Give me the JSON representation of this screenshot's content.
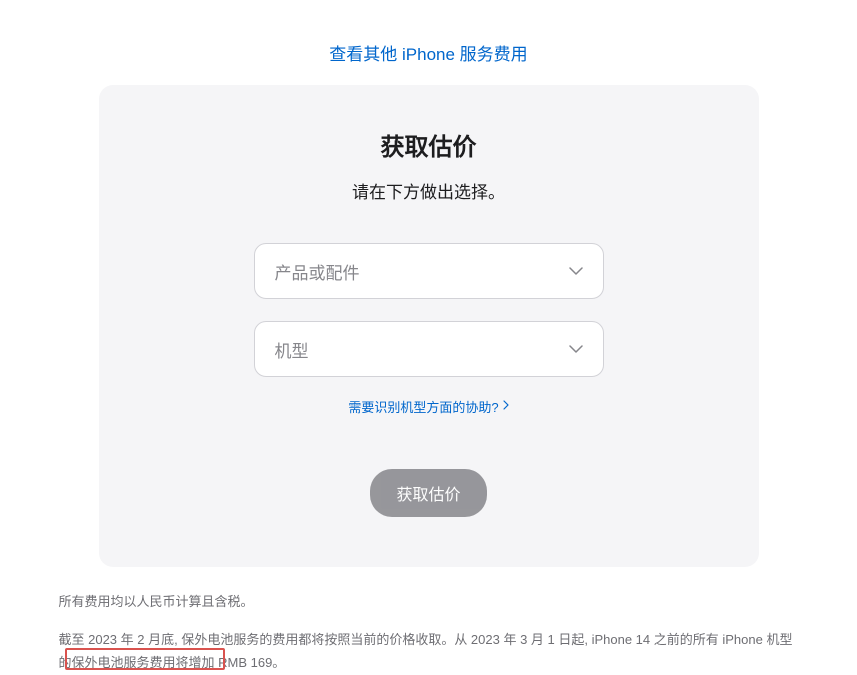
{
  "topLink": "查看其他 iPhone 服务费用",
  "card": {
    "title": "获取估价",
    "subtitle": "请在下方做出选择。",
    "select1": "产品或配件",
    "select2": "机型",
    "helpLink": "需要识别机型方面的协助?",
    "buttonLabel": "获取估价"
  },
  "footer": {
    "line1": "所有费用均以人民币计算且含税。",
    "line2": "截至 2023 年 2 月底, 保外电池服务的费用都将按照当前的价格收取。从 2023 年 3 月 1 日起, iPhone 14 之前的所有 iPhone 机型的保外电池服务费用将增加 RMB 169。"
  }
}
